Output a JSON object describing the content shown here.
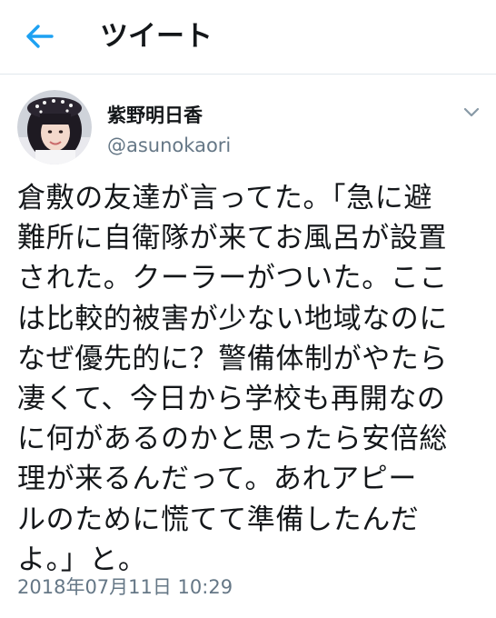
{
  "header": {
    "title": "ツイート",
    "back_icon": "arrow-left-icon",
    "accent_color": "#1da1f2"
  },
  "author": {
    "display_name": "紫野明日香",
    "handle": "@asunokaori",
    "avatar_icon": "profile-avatar",
    "menu_icon": "chevron-down-icon"
  },
  "tweet": {
    "lines": [
      "倉敷の友達が言ってた。「急に避",
      "難所に自衛隊が来てお風呂が設置",
      "された。クーラーがついた。ここ",
      "は比較的被害が少ない地域なのに",
      "なぜ優先的に？警備体制がやたら",
      "凄くて、今日から学校も再開なの",
      "に何があるのかと思ったら安倍総",
      "理が来るんだって。あれアピー",
      "ルのために慌てて準備したんだ",
      "よ。」と。"
    ],
    "timestamp": "2018年07月11日 10:29"
  }
}
